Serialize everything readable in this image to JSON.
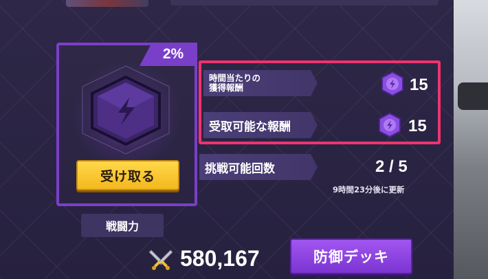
{
  "reward_card": {
    "percent": "2%",
    "claim_label": "受け取る",
    "gem_icon": "shield-gem-icon"
  },
  "stats": {
    "hourly_label_line1": "時間当たりの",
    "hourly_label_line2": "獲得報酬",
    "hourly_value": "15",
    "claimable_label": "受取可能な報酬",
    "claimable_value": "15",
    "challenge_label": "挑戦可能回数",
    "challenge_value": "2 / 5",
    "refresh_note": "9時間23分後に更新",
    "token_icon": "purple-token-icon"
  },
  "power": {
    "label": "戦闘力",
    "value": "580,167",
    "icon": "crossed-swords-icon"
  },
  "defense_deck_button": "防御デッキ",
  "colors": {
    "accent_purple": "#7a3fc8",
    "highlight_red": "#f0336e",
    "claim_yellow": "#f3b81e"
  }
}
